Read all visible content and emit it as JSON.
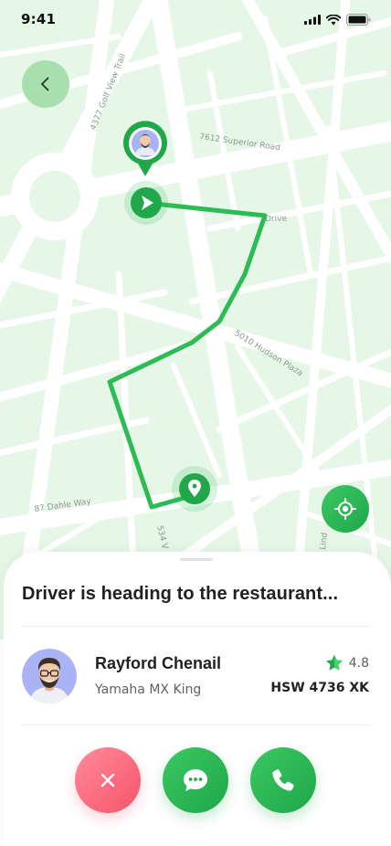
{
  "status_bar": {
    "time": "9:41"
  },
  "map": {
    "streets": {
      "golf_view": "4377 Golf View Trail",
      "superior": "7612 Superior Road",
      "drive": "Drive",
      "hudson": "5010 Hudson Plaza",
      "dahle": "87 Dahle Way",
      "bottom_road": "534 V",
      "linden": "Lind"
    }
  },
  "sheet": {
    "status_message": "Driver is heading to the restaurant...",
    "driver": {
      "name": "Rayford Chenail",
      "vehicle": "Yamaha MX King",
      "rating": "4.8",
      "plate": "HSW 4736 XK"
    }
  },
  "icons": {
    "back": "chevron-left-icon",
    "locate": "crosshair-icon",
    "cancel": "close-icon",
    "chat": "chat-bubble-icon",
    "call": "phone-icon",
    "rating": "star-icon",
    "destination": "location-pin-icon",
    "start": "navigation-arrow-icon"
  },
  "colors": {
    "primary": "#1fa74a",
    "primary_light": "#3bc862",
    "danger": "#f7546a",
    "map_background": "#e6f6e7",
    "route": "#2dbb56"
  }
}
